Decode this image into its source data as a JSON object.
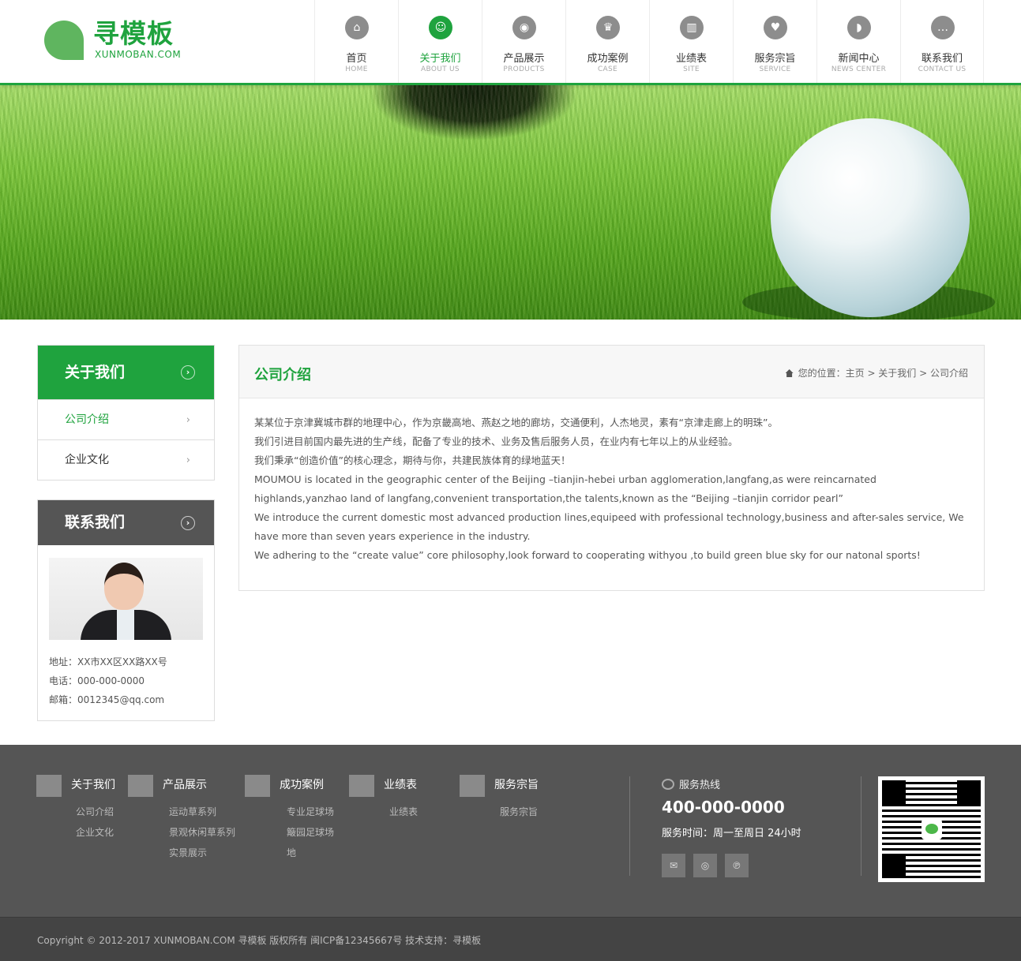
{
  "brand": {
    "name": "寻模板",
    "domain": "XUNMOBAN.COM"
  },
  "nav": [
    {
      "cn": "首页",
      "en": "HOME",
      "icon": "bank-icon",
      "glyph": "⌂",
      "active": false
    },
    {
      "cn": "关于我们",
      "en": "ABOUT US",
      "icon": "people-icon",
      "glyph": "☺",
      "active": true
    },
    {
      "cn": "产品展示",
      "en": "PRODUCTS",
      "icon": "eye-icon",
      "glyph": "◉",
      "active": false
    },
    {
      "cn": "成功案例",
      "en": "CASE",
      "icon": "crown-icon",
      "glyph": "♛",
      "active": false
    },
    {
      "cn": "业绩表",
      "en": "SITE",
      "icon": "bar-chart-icon",
      "glyph": "▥",
      "active": false
    },
    {
      "cn": "服务宗旨",
      "en": "SERVICE",
      "icon": "heart-hands-icon",
      "glyph": "♥",
      "active": false
    },
    {
      "cn": "新闻中心",
      "en": "NEWS CENTER",
      "icon": "rss-icon",
      "glyph": "◗",
      "active": false
    },
    {
      "cn": "联系我们",
      "en": "CONTACT US",
      "icon": "chat-icon",
      "glyph": "…",
      "active": false
    }
  ],
  "sidebar": {
    "about_title": "关于我们",
    "links": [
      {
        "label": "公司介绍",
        "current": true
      },
      {
        "label": "企业文化",
        "current": false
      }
    ],
    "contact_title": "联系我们",
    "address": "地址：XX市XX区XX路XX号",
    "phone": "电话：000-000-0000",
    "email": "邮箱：0012345@qq.com"
  },
  "content": {
    "title": "公司介绍",
    "breadcrumb": "您的位置：主页 > 关于我们 > 公司介绍",
    "paragraphs": [
      "某某位于京津冀城市群的地理中心，作为京畿高地、燕赵之地的廊坊，交通便利，人杰地灵，素有“京津走廊上的明珠”。",
      "我们引进目前国内最先进的生产线，配备了专业的技术、业务及售后服务人员，在业内有七年以上的从业经验。",
      "我们秉承“创造价值”的核心理念，期待与你，共建民族体育的绿地蓝天！",
      "MOUMOU is located in the geographic center of the Beijing –tianjin-hebei urban agglomeration,langfang,as were reincarnated highlands,yanzhao land of langfang,convenient transportation,the talents,known as the “Beijing –tianjin corridor pearl”",
      "We introduce the current domestic most advanced production lines,equipeed with professional technology,business and after-sales service, We have more than seven years experience in the industry.",
      "We adhering to the “create value” core philosophy,look forward to cooperating withyou ,to build green blue sky for our natonal sports!"
    ]
  },
  "footer": {
    "columns": [
      {
        "title": "关于我们",
        "icon": "people-group-icon",
        "links": [
          "公司介绍",
          "企业文化"
        ]
      },
      {
        "title": "产品展示",
        "icon": "pointer-hand-icon",
        "links": [
          "运动草系列",
          "景观休闲草系列",
          "实景展示"
        ]
      },
      {
        "title": "成功案例",
        "icon": "newspaper-icon",
        "links": [
          "专业足球场",
          "簸园足球场",
          "地"
        ]
      },
      {
        "title": "业绩表",
        "icon": "books-icon",
        "links": [
          "业绩表"
        ]
      },
      {
        "title": "服务宗旨",
        "icon": "tree-icon",
        "links": [
          "服务宗旨"
        ]
      }
    ],
    "hotline_label": "服务热线",
    "hotline_number": "400-000-0000",
    "service_hours": "服务时间：周一至周日 24小时",
    "social": [
      {
        "icon": "wechat-icon",
        "glyph": "✉"
      },
      {
        "icon": "weibo-icon",
        "glyph": "◎"
      },
      {
        "icon": "tencent-weibo-icon",
        "glyph": "℗"
      }
    ],
    "copyright": "Copyright © 2012-2017 XUNMOBAN.COM 寻模板 版权所有 闽ICP备12345667号 技术支持：寻模板"
  },
  "colors": {
    "accent": "#1fa33e",
    "footer_bg": "#555555",
    "copyright_bg": "#444444"
  }
}
